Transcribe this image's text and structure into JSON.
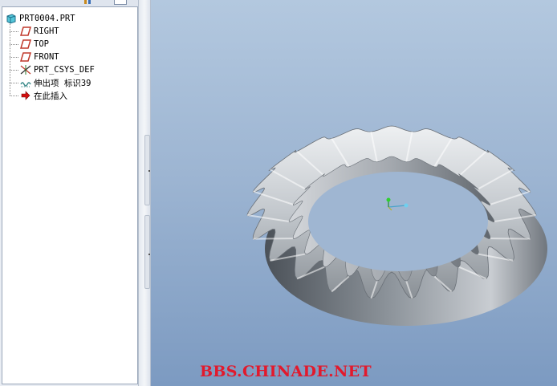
{
  "model_tree": {
    "root": "PRT0004.PRT",
    "items": [
      {
        "label": "RIGHT",
        "icon": "datum-plane-icon"
      },
      {
        "label": "TOP",
        "icon": "datum-plane-icon"
      },
      {
        "label": "FRONT",
        "icon": "datum-plane-icon"
      },
      {
        "label": "PRT_CSYS_DEF",
        "icon": "coordinate-system-icon"
      },
      {
        "label": "伸出项 标识39",
        "icon": "protrusion-feature-icon"
      },
      {
        "label": "在此插入",
        "icon": "insert-here-arrow-icon"
      }
    ]
  },
  "viewport": {
    "background_top": "#b3c8df",
    "background_bottom": "#7c9ac1",
    "model": "bevel-gear-ring"
  },
  "watermark": {
    "text": "BBS.CHINADE.NET",
    "color": "#e2192c"
  },
  "colors": {
    "datum_plane": "#c0392b",
    "insert_arrow": "#d20f0f",
    "feature_icon": "#3a8a8a"
  }
}
